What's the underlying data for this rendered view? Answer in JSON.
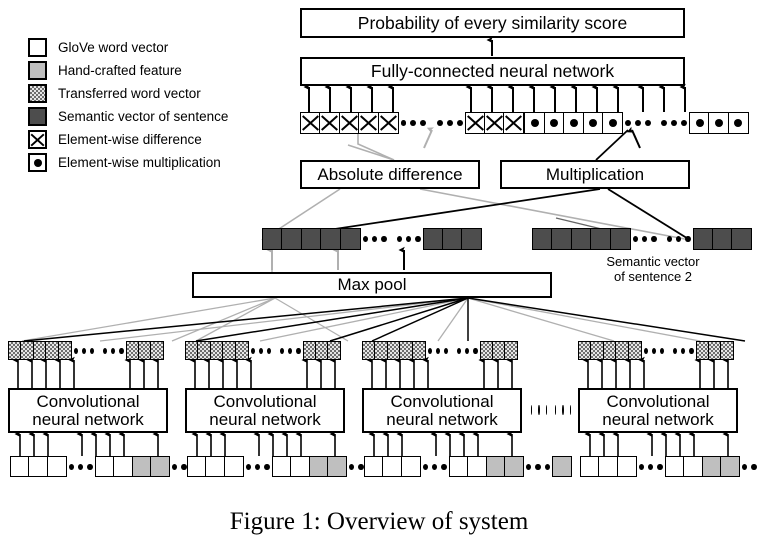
{
  "figure": {
    "caption": "Figure 1: Overview of system"
  },
  "legend": {
    "items": [
      {
        "label": "GloVe word vector",
        "swatch": "white",
        "icon": "square-white-icon"
      },
      {
        "label": "Hand-crafted feature",
        "swatch": "gray",
        "icon": "square-gray-icon"
      },
      {
        "label": "Transferred word vector",
        "swatch": "transferred",
        "icon": "square-hatched-icon"
      },
      {
        "label": "Semantic vector of sentence",
        "swatch": "dark",
        "icon": "square-dark-icon"
      },
      {
        "label": "Element-wise difference",
        "swatch": "cross",
        "icon": "cross-square-icon"
      },
      {
        "label": "Element-wise multiplication",
        "swatch": "dot",
        "icon": "dot-square-icon"
      }
    ]
  },
  "boxes": {
    "output": "Probability of every similarity score",
    "fully_connected": "Fully-connected neural network",
    "absolute_difference": "Absolute difference",
    "multiplication": "Multiplication",
    "max_pool": "Max pool",
    "cnn": "Convolutional\nneural network",
    "cnn_line1": "Convolutional",
    "cnn_line2": "neural network"
  },
  "annotations": {
    "semantic_vector_2_line1": "Semantic vector",
    "semantic_vector_2_line2": "of sentence 2"
  },
  "colors": {
    "stroke": "#000000",
    "light_stroke": "#b0b0b0",
    "white_cell": "#ffffff",
    "gray_cell": "#bfbfbf",
    "dark_cell": "#4d4d4d",
    "background": "#ffffff"
  },
  "diagram_data": {
    "type": "diagram",
    "layers_bottom_to_top": [
      "input word/feature vectors",
      "convolutional neural network",
      "transferred word vectors",
      "max pool",
      "semantic vector of sentence",
      "absolute difference / multiplication",
      "element-wise combination vector",
      "fully-connected neural network",
      "probability of every similarity score"
    ],
    "cnn_block_count_shown": 4,
    "cnn_blocks_elided": true,
    "concat_row": {
      "groups": [
        {
          "kind": "cross",
          "count": 5
        },
        {
          "kind": "ellipsis"
        },
        {
          "kind": "cross",
          "count": 3
        },
        {
          "kind": "dot",
          "count": 5
        },
        {
          "kind": "ellipsis"
        },
        {
          "kind": "dot",
          "count": 3
        }
      ]
    },
    "semantic_rows": [
      {
        "name": "sentence 1",
        "groups": [
          {
            "count": 5
          },
          {
            "kind": "ellipsis"
          },
          {
            "count": 3
          }
        ]
      },
      {
        "name": "sentence 2",
        "groups": [
          {
            "count": 5
          },
          {
            "kind": "ellipsis"
          },
          {
            "count": 3
          }
        ]
      }
    ],
    "cnn_output_row_per_block": [
      {
        "count": 5
      },
      {
        "kind": "ellipsis"
      },
      {
        "count": 3
      }
    ],
    "cnn_input_row_per_block": [
      {
        "kind": "white",
        "count": 3
      },
      {
        "kind": "ellipsis"
      },
      {
        "kind": "white",
        "count": 2
      },
      {
        "kind": "gray",
        "count": 2
      },
      {
        "kind": "ellipsis"
      },
      {
        "kind": "gray",
        "count": 1
      }
    ]
  }
}
